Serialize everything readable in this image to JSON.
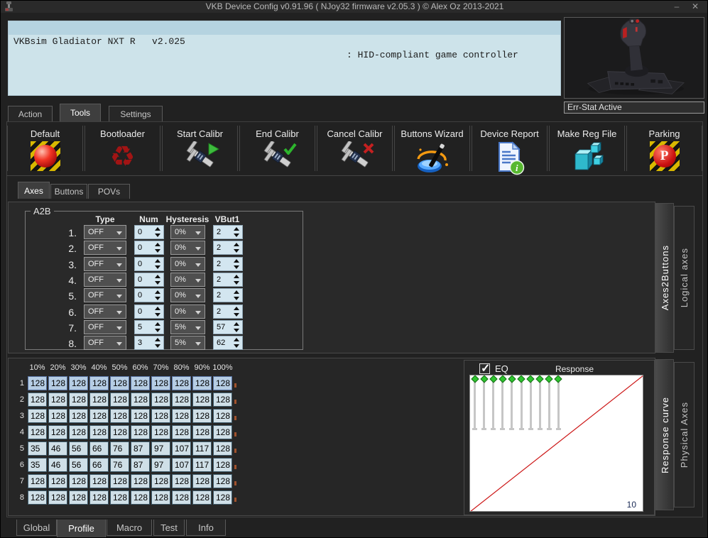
{
  "window": {
    "title": "VKB Device Config v0.91.96 ( NJoy32 firmware v2.05.3 ) © Alex Oz 2013-2021",
    "minimize_label": "–",
    "close_label": "✕"
  },
  "device_info": {
    "name_line": "VKBsim Gladiator NXT R   v2.025",
    "hid_line": ": HID-compliant game controller"
  },
  "err_stat_label": "Err-Stat Active",
  "main_tabs": [
    {
      "label": "Action",
      "active": false
    },
    {
      "label": "Tools",
      "active": true
    },
    {
      "label": "Settings",
      "active": false
    }
  ],
  "toolbar": {
    "items": [
      {
        "label": "Default",
        "icon": "default-hazard-ball-icon"
      },
      {
        "label": "Bootloader",
        "icon": "recycle-icon"
      },
      {
        "label": "Start Calibr",
        "icon": "caliper-play-icon"
      },
      {
        "label": "End Calibr",
        "icon": "caliper-check-icon"
      },
      {
        "label": "Cancel Calibr",
        "icon": "caliper-cross-icon"
      },
      {
        "label": "Buttons Wizard",
        "icon": "wand-button-icon"
      },
      {
        "label": "Device Report",
        "icon": "document-info-icon"
      },
      {
        "label": "Make Reg File",
        "icon": "registry-cubes-icon"
      },
      {
        "label": "Parking",
        "icon": "parking-hazard-icon"
      }
    ]
  },
  "section_tabs": [
    {
      "label": "Axes",
      "active": true
    },
    {
      "label": "Buttons",
      "active": false
    },
    {
      "label": "POVs",
      "active": false
    }
  ],
  "a2b": {
    "group_label": "A2B",
    "headers": [
      "Type",
      "Num",
      "Hysteresis",
      "VBut1"
    ],
    "rows": [
      {
        "index": "1.",
        "type": "OFF",
        "num": "0",
        "hysteresis": "0%",
        "vbut1": "2"
      },
      {
        "index": "2.",
        "type": "OFF",
        "num": "0",
        "hysteresis": "0%",
        "vbut1": "2"
      },
      {
        "index": "3.",
        "type": "OFF",
        "num": "0",
        "hysteresis": "0%",
        "vbut1": "2"
      },
      {
        "index": "4.",
        "type": "OFF",
        "num": "0",
        "hysteresis": "0%",
        "vbut1": "2"
      },
      {
        "index": "5.",
        "type": "OFF",
        "num": "0",
        "hysteresis": "0%",
        "vbut1": "2"
      },
      {
        "index": "6.",
        "type": "OFF",
        "num": "0",
        "hysteresis": "0%",
        "vbut1": "2"
      },
      {
        "index": "7.",
        "type": "OFF",
        "num": "5",
        "hysteresis": "5%",
        "vbut1": "57"
      },
      {
        "index": "8.",
        "type": "OFF",
        "num": "3",
        "hysteresis": "5%",
        "vbut1": "62"
      }
    ]
  },
  "side_tabs_upper": [
    {
      "label": "Axes2Buttons",
      "active": true
    },
    {
      "label": "Logical axes",
      "active": false
    }
  ],
  "curve_grid": {
    "col_headers": [
      "10%",
      "20%",
      "30%",
      "40%",
      "50%",
      "60%",
      "70%",
      "80%",
      "90%",
      "100%"
    ],
    "row_labels": [
      "1",
      "2",
      "3",
      "4",
      "5",
      "6",
      "7",
      "8"
    ],
    "highlighted_row": 0,
    "values": [
      [
        128,
        128,
        128,
        128,
        128,
        128,
        128,
        128,
        128,
        128
      ],
      [
        128,
        128,
        128,
        128,
        128,
        128,
        128,
        128,
        128,
        128
      ],
      [
        128,
        128,
        128,
        128,
        128,
        128,
        128,
        128,
        128,
        128
      ],
      [
        128,
        128,
        128,
        128,
        128,
        128,
        128,
        128,
        128,
        128
      ],
      [
        35,
        46,
        56,
        66,
        76,
        87,
        97,
        107,
        117,
        128
      ],
      [
        35,
        46,
        56,
        66,
        76,
        87,
        97,
        107,
        117,
        128
      ],
      [
        128,
        128,
        128,
        128,
        128,
        128,
        128,
        128,
        128,
        128
      ],
      [
        128,
        128,
        128,
        128,
        128,
        128,
        128,
        128,
        128,
        128
      ]
    ]
  },
  "response": {
    "eq_label": "EQ",
    "eq_checked": true,
    "title": "Response",
    "corner_label": "10",
    "slider_values": [
      128,
      128,
      128,
      128,
      128,
      128,
      128,
      128,
      128,
      128
    ],
    "curve": "linear-diagonal",
    "curve_color": "#cc1515"
  },
  "side_tabs_lower": [
    {
      "label": "Response curve",
      "active": true
    },
    {
      "label": "Physical Axes",
      "active": false
    }
  ],
  "bottom_tabs": [
    {
      "label": "Global",
      "active": false
    },
    {
      "label": "Profile",
      "active": true
    },
    {
      "label": "Macro",
      "active": false
    },
    {
      "label": "Test",
      "active": false
    },
    {
      "label": "Info",
      "active": false
    }
  ],
  "colors": {
    "window_bg": "#212121",
    "panel_bg": "#292929",
    "device_box_bg": "#cde3ea",
    "device_line_bg": "#b5d3e0",
    "spinner_bg": "#d3e6f0",
    "grid_cell_bg": "#cfdfe7",
    "grid_cell_highlight_bg": "#b6cde4",
    "accent_red": "#cc1515",
    "slider_green": "#2dc42d"
  }
}
